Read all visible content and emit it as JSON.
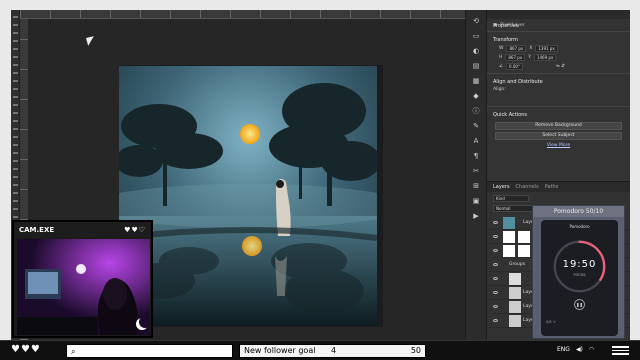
{
  "photoshop": {
    "properties": {
      "title": "Properties",
      "layer_type": "Pixel Layer",
      "transform_title": "Transform",
      "w": "867 px",
      "x": "1391 px",
      "h": "867 px",
      "y": "1469 px",
      "angle": "0.00°",
      "align_title": "Align and Distribute",
      "align_label": "Align:",
      "quick_actions_title": "Quick Actions",
      "remove_bg_label": "Remove Background",
      "select_subject_label": "Select Subject",
      "view_more_label": "View More"
    },
    "layers_panel": {
      "tabs": [
        "Layers",
        "Channels",
        "Paths"
      ],
      "active_tab": "Layers",
      "filter": "Kind",
      "blend_mode": "Normal",
      "layers": [
        {
          "name": "Layer 1"
        },
        {
          "name": ""
        },
        {
          "name": ""
        },
        {
          "name": "Groups"
        },
        {
          "name": ""
        },
        {
          "name": "Layer 4"
        },
        {
          "name": "Layer 3"
        },
        {
          "name": "Layer 1"
        }
      ]
    }
  },
  "pomodoro": {
    "title": "Pomodoro 50/10",
    "app_title": "Pomodoro",
    "time": "19:50",
    "mode": "FOCUS",
    "progress": 0.34,
    "footer": "0/4 ☼",
    "colors": {
      "ring_progress": "#e8617a",
      "ring_track": "#45464e"
    }
  },
  "webcam": {
    "title": "CAM.EXE",
    "hearts": "♥♥♡"
  },
  "taskbar": {
    "hearts": "♥♥♥",
    "search_value": "",
    "goal_label": "New follower goal",
    "goal_current": "4",
    "goal_target": "50",
    "lang": "ENG"
  }
}
